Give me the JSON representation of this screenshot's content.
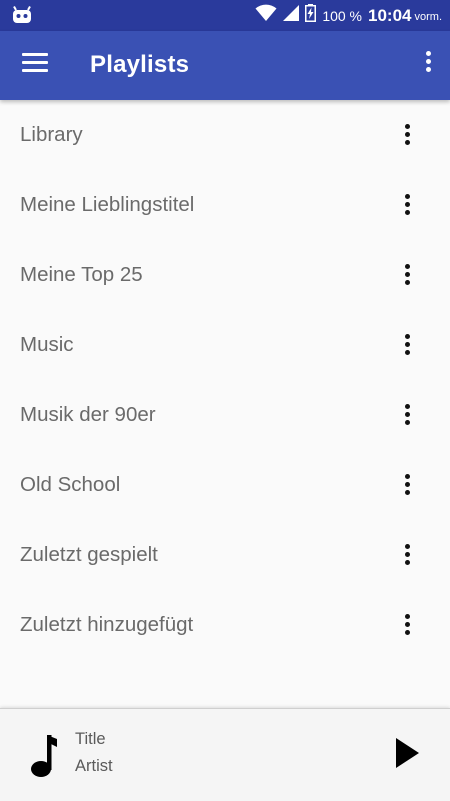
{
  "status_bar": {
    "battery_text": "100 %",
    "time": "10:04",
    "ampm": "vorm.",
    "icons": [
      "android-notification-icon",
      "wifi-icon",
      "cell-signal-icon",
      "battery-charging-icon"
    ]
  },
  "app_bar": {
    "title": "Playlists",
    "menu_icon": "hamburger-menu-icon",
    "overflow_icon": "more-vert-icon"
  },
  "playlists": [
    {
      "label": "Library"
    },
    {
      "label": "Meine Lieblingstitel"
    },
    {
      "label": "Meine Top 25"
    },
    {
      "label": "Music"
    },
    {
      "label": "Musik der 90er"
    },
    {
      "label": "Old School"
    },
    {
      "label": "Zuletzt gespielt"
    },
    {
      "label": "Zuletzt hinzugefügt"
    }
  ],
  "player": {
    "title": "Title",
    "artist": "Artist",
    "icon": "music-note-icon",
    "play_icon": "play-icon"
  },
  "colors": {
    "status_bar": "#2a3a9c",
    "app_bar": "#3a51b4",
    "background": "#fafafa",
    "text": "#6a6a6a"
  }
}
